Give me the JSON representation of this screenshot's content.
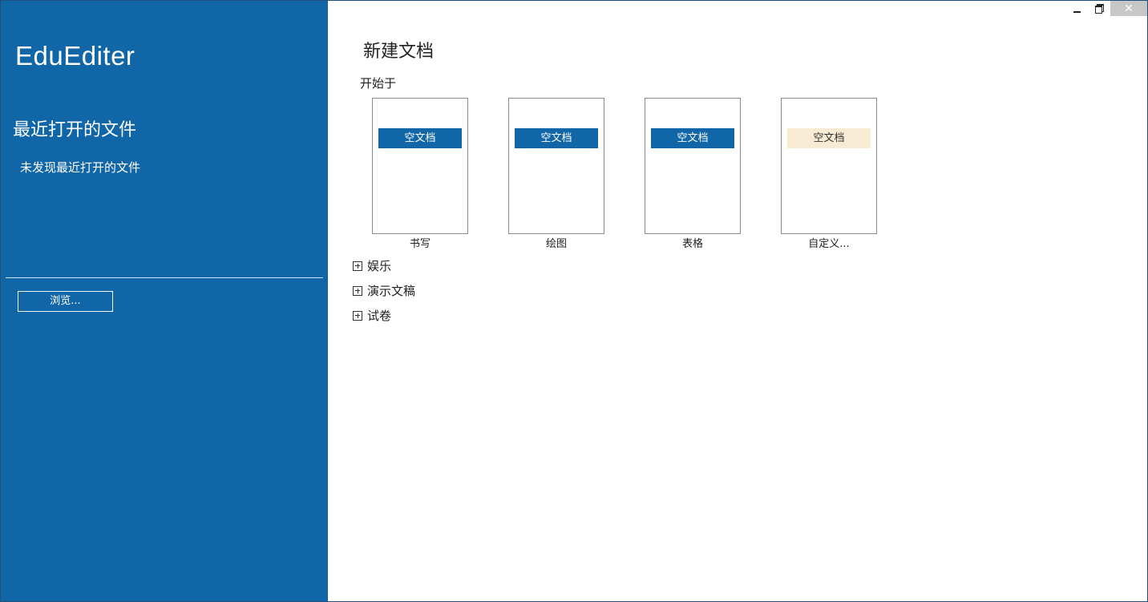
{
  "app": {
    "title": "EduEditer"
  },
  "sidebar": {
    "recent_heading": "最近打开的文件",
    "recent_empty_text": "未发现最近打开的文件",
    "browse_label": "浏览..."
  },
  "window_controls": {
    "minimize_icon": "minimize-icon",
    "restore_icon": "restore-icon",
    "close_icon": "close-icon",
    "close_glyph": "✕"
  },
  "main": {
    "title": "新建文档",
    "start_label": "开始于",
    "templates": [
      {
        "badge": "空文档",
        "label": "书写"
      },
      {
        "badge": "空文档",
        "label": "绘图"
      },
      {
        "badge": "空文档",
        "label": "表格"
      },
      {
        "badge": "空文档",
        "label": "自定义..."
      }
    ],
    "groups": [
      {
        "label": "娱乐"
      },
      {
        "label": "演示文稿"
      },
      {
        "label": "试卷"
      }
    ]
  },
  "colors": {
    "sidebar_bg": "#1166a8",
    "badge_blue": "#1166a8",
    "badge_highlight": "#f7ecd3",
    "close_button_bg": "#c7c7c7"
  }
}
